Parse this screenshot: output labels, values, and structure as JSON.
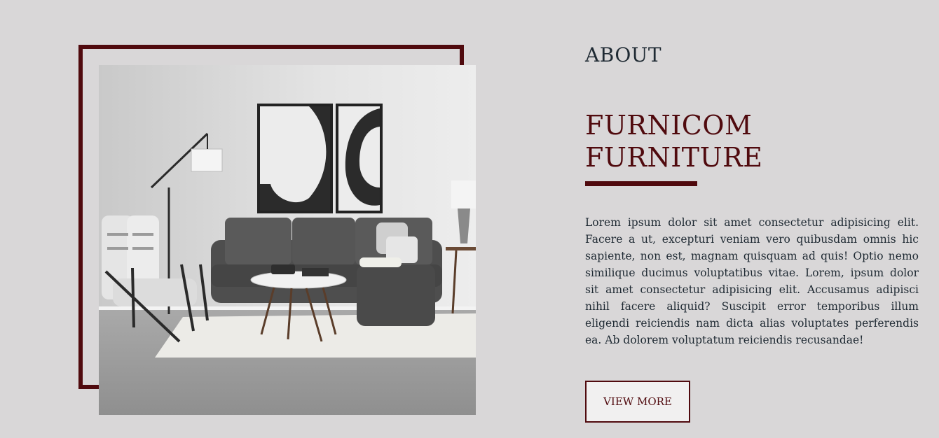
{
  "about": {
    "section_label": "ABOUT",
    "title_line1": "FURNICOM",
    "title_line2": "FURNITURE",
    "paragraph": "Lorem ipsum dolor sit amet consectetur adipisicing elit. Facere a ut, excepturi veniam vero quibusdam omnis hic sapiente, non est, magnam quisquam ad quis! Optio nemo similique ducimus voluptatibus vitae. Lorem, ipsum dolor sit amet consectetur adipisicing elit. Accusamus adipisci nihil facere aliquid? Suscipit error temporibus illum eligendi reiciendis nam dicta alias voluptates perferendis ea. Ab dolorem voluptatum reiciendis recusandae!",
    "button_label": "VIEW MORE"
  },
  "colors": {
    "accent": "#500a0e",
    "background": "#d9d7d8",
    "text": "#1f2a33"
  }
}
